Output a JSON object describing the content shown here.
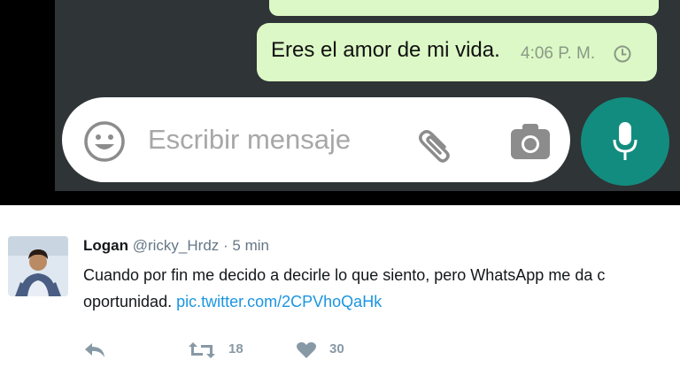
{
  "whatsapp": {
    "message": {
      "text": "Eres el amor de mi vida.",
      "time": "4:06 P. M."
    },
    "input": {
      "placeholder": "Escribir mensaje"
    },
    "icons": {
      "clock": "clock-icon",
      "emoji": "emoji-icon",
      "attach": "paperclip-icon",
      "camera": "camera-icon",
      "mic": "microphone-icon"
    },
    "colors": {
      "bubble": "#dcf8c6",
      "background": "#2f3437",
      "mic_button": "#128c7e"
    }
  },
  "tweet": {
    "name": "Logan",
    "handle": "@ricky_Hrdz",
    "separator": "·",
    "time": "5 min",
    "text_line1": "Cuando por fin me decido a decirle lo que siento, pero WhatsApp me da c",
    "text_line2": "oportunidad.",
    "link": "pic.twitter.com/2CPVhoQaHk",
    "actions": {
      "retweets": "18",
      "likes": "30"
    },
    "colors": {
      "link": "#1b95e0",
      "muted": "#657786",
      "action": "#8899a6"
    }
  }
}
